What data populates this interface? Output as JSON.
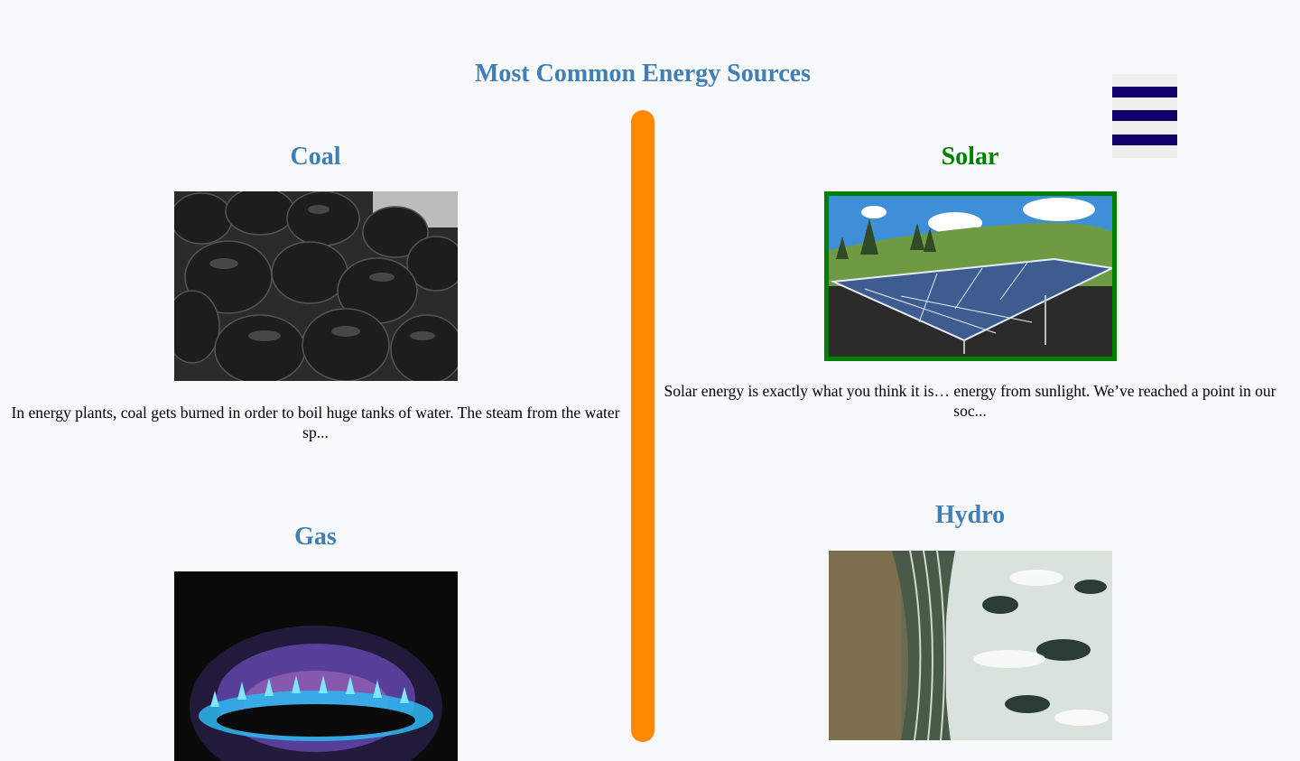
{
  "page": {
    "title": "Most Common Energy Sources"
  },
  "menu": {
    "icon": "hamburger-menu-icon"
  },
  "colors": {
    "title": "#3f7fb5",
    "active_title": "#008000",
    "divider": "#ff8800",
    "menu_bar": "#11006a"
  },
  "sources": [
    {
      "name": "Coal",
      "image": "coal-pile-photo",
      "description": "In energy plants, coal gets burned in order to boil huge tanks of water. The steam from the water sp...",
      "active": false
    },
    {
      "name": "Solar",
      "image": "solar-panels-photo",
      "description": "Solar energy is exactly what you think it is… energy from sunlight. We’ve reached a point in our soc...",
      "active": true
    },
    {
      "name": "Gas",
      "image": "gas-flame-photo",
      "description": "",
      "active": false
    },
    {
      "name": "Hydro",
      "image": "waterfall-photo",
      "description": "",
      "active": false
    }
  ]
}
